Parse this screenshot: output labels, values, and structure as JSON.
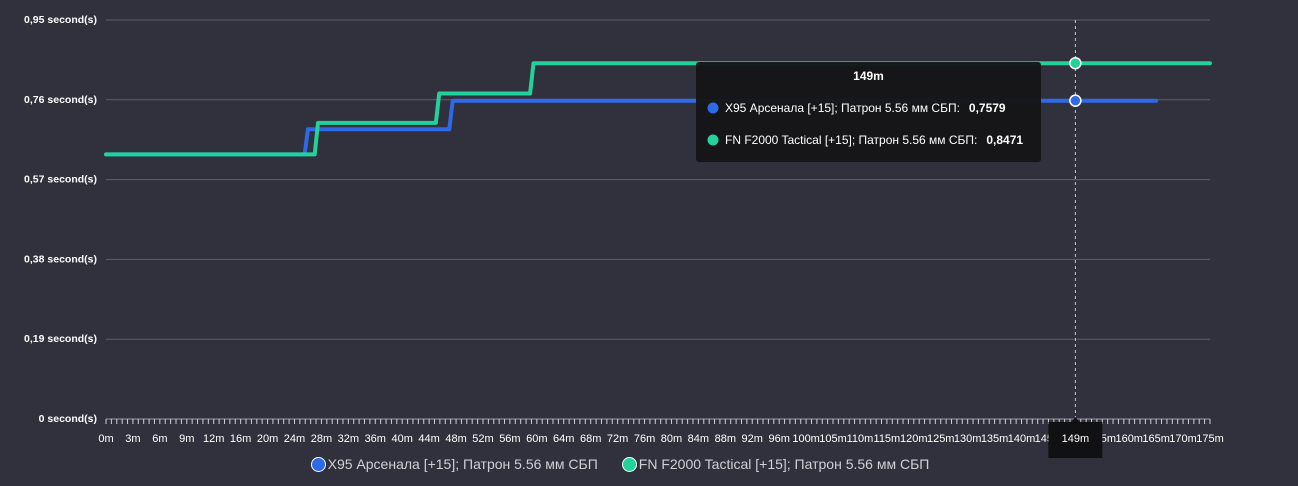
{
  "chart_data": {
    "type": "line",
    "step": true,
    "x_categories": [
      "0m",
      "3m",
      "6m",
      "9m",
      "12m",
      "16m",
      "20m",
      "24m",
      "28m",
      "32m",
      "36m",
      "40m",
      "44m",
      "48m",
      "52m",
      "56m",
      "60m",
      "64m",
      "68m",
      "72m",
      "76m",
      "80m",
      "84m",
      "88m",
      "92m",
      "96m",
      "100m",
      "105m",
      "110m",
      "115m",
      "120m",
      "125m",
      "130m",
      "135m",
      "140m",
      "145m",
      "149m",
      "155m",
      "160m",
      "165m",
      "170m",
      "175m"
    ],
    "y_ticks": [
      "0 second(s)",
      "0,19 second(s)",
      "0,38 second(s)",
      "0,57 second(s)",
      "0,76 second(s)",
      "0,95 second(s)"
    ],
    "ylim": [
      0,
      0.95
    ],
    "grid": true,
    "legend_position": "bottom",
    "series": [
      {
        "name": "X95 Арсенала [+15]; Патрон 5.56 мм СБП",
        "color": "#2f6ae6",
        "points": [
          [
            0,
            0.63
          ],
          [
            25.5,
            0.63
          ],
          [
            26,
            0.69
          ],
          [
            47,
            0.69
          ],
          [
            47.5,
            0.7579
          ],
          [
            165,
            0.7579
          ]
        ]
      },
      {
        "name": "FN F2000 Tactical [+15]; Патрон 5.56 мм СБП",
        "color": "#23d19a",
        "points": [
          [
            0,
            0.63
          ],
          [
            27,
            0.63
          ],
          [
            27.5,
            0.705
          ],
          [
            45,
            0.705
          ],
          [
            45.5,
            0.775
          ],
          [
            59,
            0.775
          ],
          [
            59.5,
            0.8471
          ],
          [
            175,
            0.8471
          ]
        ]
      }
    ],
    "hover": {
      "x_label": "149m",
      "rows": [
        {
          "label": "X95 Арсенала [+15]; Патрон 5.56 мм СБП:",
          "value": "0,7579"
        },
        {
          "label": "FN F2000 Tactical [+15]; Патрон 5.56 мм СБП:",
          "value": "0,8471"
        }
      ]
    }
  }
}
